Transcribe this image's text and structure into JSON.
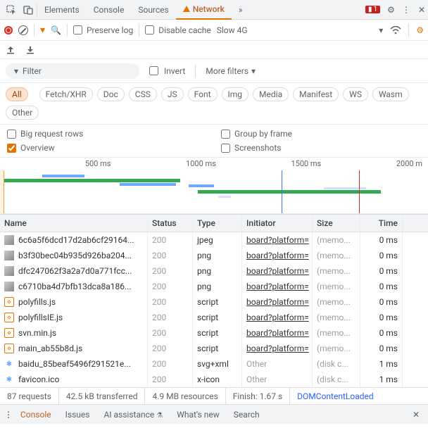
{
  "tabs": {
    "elements": "Elements",
    "console": "Console",
    "sources": "Sources",
    "network": "Network",
    "issue_count": "1"
  },
  "toolbar": {
    "preserve": "Preserve log",
    "disable_cache": "Disable cache",
    "throttle": "Slow 4G"
  },
  "filter": {
    "label": "Filter",
    "invert": "Invert",
    "more": "More filters"
  },
  "chips": {
    "all": "All",
    "fetch": "Fetch/XHR",
    "doc": "Doc",
    "css": "CSS",
    "js": "JS",
    "font": "Font",
    "img": "Img",
    "media": "Media",
    "manifest": "Manifest",
    "ws": "WS",
    "wasm": "Wasm",
    "other": "Other"
  },
  "opts": {
    "big": "Big request rows",
    "group": "Group by frame",
    "overview": "Overview",
    "screenshots": "Screenshots"
  },
  "timeline": {
    "ticks": [
      "500 ms",
      "1000 ms",
      "1500 ms",
      "2000 m"
    ]
  },
  "headers": {
    "name": "Name",
    "status": "Status",
    "type": "Type",
    "initiator": "Initiator",
    "size": "Size",
    "time": "Time"
  },
  "rows": [
    {
      "icon": "img",
      "name": "6c6a5f6dcd17d2ab6cf29164...",
      "status": "200",
      "type": "jpeg",
      "initiator": "board?platform=",
      "size": "(memo...",
      "time": "0 ms"
    },
    {
      "icon": "img",
      "name": "b3f30bec04b935d926ba204...",
      "status": "200",
      "type": "png",
      "initiator": "board?platform=",
      "size": "(memo...",
      "time": "0 ms"
    },
    {
      "icon": "img",
      "name": "dfc247062f3a2a7d0a771fcc...",
      "status": "200",
      "type": "png",
      "initiator": "board?platform=",
      "size": "(memo...",
      "time": "0 ms"
    },
    {
      "icon": "img",
      "name": "c6710ba4d7bfb13dca8a186...",
      "status": "200",
      "type": "png",
      "initiator": "board?platform=",
      "size": "(memo...",
      "time": "0 ms"
    },
    {
      "icon": "js",
      "name": "polyfills.js",
      "status": "200",
      "type": "script",
      "initiator": "board?platform=",
      "size": "(memo...",
      "time": "0 ms"
    },
    {
      "icon": "js",
      "name": "polyfillsIE.js",
      "status": "200",
      "type": "script",
      "initiator": "board?platform=",
      "size": "(memo...",
      "time": "0 ms"
    },
    {
      "icon": "js",
      "name": "svn.min.js",
      "status": "200",
      "type": "script",
      "initiator": "board?platform=",
      "size": "(memo...",
      "time": "0 ms"
    },
    {
      "icon": "js",
      "name": "main_ab55b8d.js",
      "status": "200",
      "type": "script",
      "initiator": "board?platform=",
      "size": "(memo...",
      "time": "0 ms"
    },
    {
      "icon": "svg",
      "name": "baidu_85beaf5496f291521e...",
      "status": "200",
      "type": "svg+xml",
      "initiator": "Other",
      "size": "(disk c...",
      "time": "1 ms"
    },
    {
      "icon": "svg",
      "name": "favicon.ico",
      "status": "200",
      "type": "x-icon",
      "initiator": "Other",
      "size": "(disk c...",
      "time": "1 ms"
    }
  ],
  "summary": {
    "requests": "87 requests",
    "transferred": "42.5 kB transferred",
    "resources": "4.9 MB resources",
    "finish": "Finish: 1.67 s",
    "dcl": "DOMContentLoaded"
  },
  "drawer": {
    "console": "Console",
    "issues": "Issues",
    "ai": "AI assistance",
    "whatsnew": "What's new",
    "search": "Search"
  }
}
